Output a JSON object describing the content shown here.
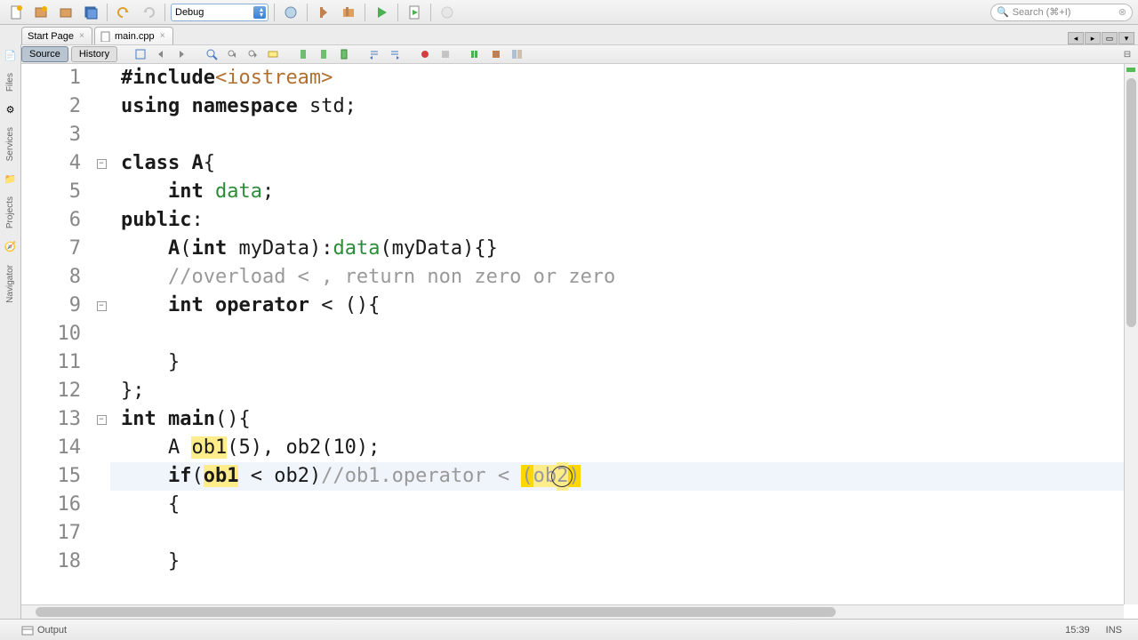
{
  "toolbar": {
    "config": "Debug",
    "search_placeholder": "Search (⌘+I)"
  },
  "tabs": [
    {
      "label": "Start Page",
      "active": false
    },
    {
      "label": "main.cpp",
      "active": true
    }
  ],
  "subtabs": {
    "source": "Source",
    "history": "History"
  },
  "sidebar": {
    "files": "Files",
    "services": "Services",
    "projects": "Projects",
    "navigator": "Navigator"
  },
  "code": {
    "lines": [
      {
        "n": 1,
        "tokens": [
          [
            "prep",
            "#include"
          ],
          [
            "inc",
            "<iostream>"
          ]
        ]
      },
      {
        "n": 2,
        "tokens": [
          [
            "kw",
            "using"
          ],
          [
            "id",
            " "
          ],
          [
            "kw",
            "namespace"
          ],
          [
            "id",
            " std;"
          ]
        ]
      },
      {
        "n": 3,
        "tokens": []
      },
      {
        "n": 4,
        "fold": true,
        "tokens": [
          [
            "kw",
            "class"
          ],
          [
            "id",
            " "
          ],
          [
            "type",
            "A"
          ],
          [
            "id",
            "{"
          ]
        ]
      },
      {
        "n": 5,
        "tokens": [
          [
            "id",
            "    "
          ],
          [
            "kw",
            "int"
          ],
          [
            "id",
            " "
          ],
          [
            "mem",
            "data"
          ],
          [
            "id",
            ";"
          ]
        ]
      },
      {
        "n": 6,
        "tokens": [
          [
            "kw",
            "public"
          ],
          [
            "id",
            ":"
          ]
        ]
      },
      {
        "n": 7,
        "tokens": [
          [
            "id",
            "    "
          ],
          [
            "type",
            "A"
          ],
          [
            "id",
            "("
          ],
          [
            "kw",
            "int"
          ],
          [
            "id",
            " myData):"
          ],
          [
            "mem",
            "data"
          ],
          [
            "id",
            "(myData){}"
          ]
        ]
      },
      {
        "n": 8,
        "tokens": [
          [
            "id",
            "    "
          ],
          [
            "comment",
            "//overload < , return non zero or zero"
          ]
        ]
      },
      {
        "n": 9,
        "fold": true,
        "tokens": [
          [
            "id",
            "    "
          ],
          [
            "kw",
            "int"
          ],
          [
            "id",
            " "
          ],
          [
            "kw",
            "operator"
          ],
          [
            "id",
            " < (){"
          ]
        ]
      },
      {
        "n": 10,
        "tokens": []
      },
      {
        "n": 11,
        "tokens": [
          [
            "id",
            "    }"
          ]
        ]
      },
      {
        "n": 12,
        "tokens": [
          [
            "id",
            "};"
          ]
        ]
      },
      {
        "n": 13,
        "fold": true,
        "tokens": [
          [
            "kw",
            "int"
          ],
          [
            "id",
            " "
          ],
          [
            "type",
            "main"
          ],
          [
            "id",
            "(){"
          ]
        ]
      },
      {
        "n": 14,
        "tokens": [
          [
            "id",
            "    A "
          ],
          [
            "hl",
            "ob1"
          ],
          [
            "id",
            "(5), ob2(10);"
          ]
        ]
      },
      {
        "n": 15,
        "current": true,
        "special": "line15"
      },
      {
        "n": 16,
        "tokens": [
          [
            "id",
            "    {"
          ]
        ]
      },
      {
        "n": 17,
        "tokens": []
      },
      {
        "n": 18,
        "tokens": [
          [
            "id",
            "    }"
          ]
        ]
      }
    ],
    "line15": {
      "prefix": "    ",
      "if": "if",
      "open": "(",
      "ob1": "ob1",
      "mid": " < ob2)",
      "comment_pre": "//ob1.operator < ",
      "lp": "(",
      "ob2": "ob2",
      "rp": ")"
    }
  },
  "status": {
    "output": "Output",
    "cursor": "15:39",
    "mode": "INS"
  }
}
